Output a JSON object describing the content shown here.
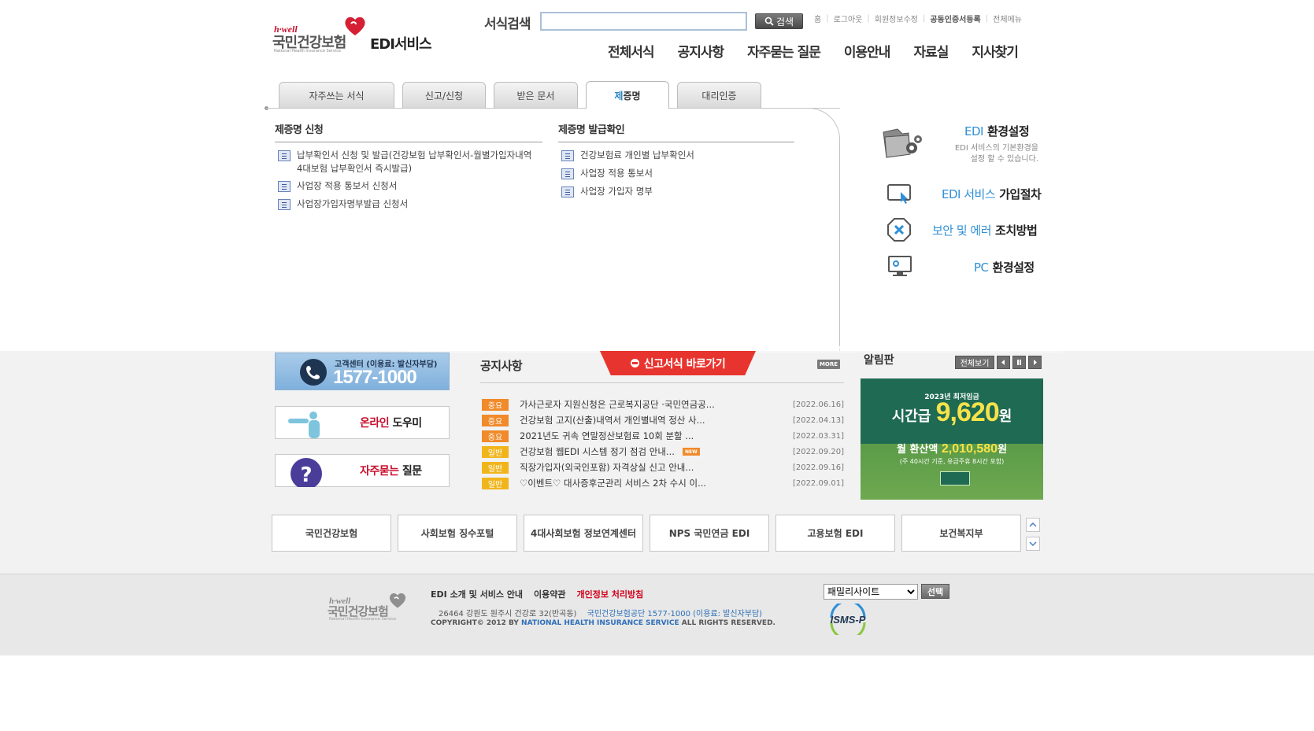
{
  "brand": {
    "hwell": "h·well",
    "name_kr": "국민건강보험",
    "name_en": "National Health Insurance Service",
    "service": "EDI서비스",
    "accent": "#c8102e"
  },
  "search": {
    "label": "서식검색",
    "value": "",
    "placeholder": "",
    "button": "검색"
  },
  "util_links": [
    "홈",
    "로그아웃",
    "회원정보수정",
    "공동인증서등록",
    "전체메뉴"
  ],
  "gnb": [
    "전체서식",
    "공지사항",
    "자주묻는 질문",
    "이용안내",
    "자료실",
    "지사찾기"
  ],
  "tabs": [
    {
      "label": "자주쓰는 서식"
    },
    {
      "label": "신고/신청"
    },
    {
      "label": "받은 문서"
    },
    {
      "label_first": "제",
      "label_rest": "증명",
      "active": true
    },
    {
      "label": "대리인증"
    }
  ],
  "cert_apply": {
    "title": "제증명 신청",
    "items": [
      "납부확인서 신청 및 발급(건강보험 납부확인서-월별가입자내역 4대보험 납부확인서 즉시발급)",
      "사업장 적용 통보서 신청서",
      "사업장가입자명부발급 신청서"
    ]
  },
  "cert_issue": {
    "title": "제증명 발급확인",
    "items": [
      "건강보험료 개인별 납부확인서",
      "사업장 적용 통보서",
      "사업장 가입자 명부"
    ]
  },
  "side_menu": {
    "env": {
      "hl": "EDI",
      "label": "환경설정",
      "desc1": "EDI 서비스의 기본환경을",
      "desc2": "설정 할 수 있습니다."
    },
    "join": {
      "hl": "EDI 서비스",
      "label": "가입절차"
    },
    "security": {
      "hl": "보안 및 에러",
      "label": "조치방법"
    },
    "pc": {
      "hl": "PC",
      "label": "환경설정"
    }
  },
  "customer_center": {
    "label": "고객센터 (이용료: 발신자부담)",
    "number": "1577-1000"
  },
  "quick": {
    "online_red": "온라인",
    "online_rest": " 도우미",
    "faq_red": "자주묻는",
    "faq_rest": " 질문"
  },
  "notice": {
    "title": "공지사항",
    "shortcut": "신고서식 바로가기",
    "more": "MORE",
    "new_label": "NEW",
    "rows": [
      {
        "badge": "중요",
        "type": "important",
        "text": "가사근로자 지원신청은 근로복지공단 ·국민연금공...",
        "date": "[2022.06.16]"
      },
      {
        "badge": "중요",
        "type": "important",
        "text": "건강보험 고지(산출)내역서 개인별내역 정산 사...",
        "date": "[2022.04.13]"
      },
      {
        "badge": "중요",
        "type": "important",
        "text": "2021년도 귀속 연말정산보험료 10회 분할 ...",
        "date": "[2022.03.31]"
      },
      {
        "badge": "일반",
        "type": "normal",
        "text": "건강보험 웹EDI 시스템 정기 점검 안내...",
        "date": "[2022.09.20]",
        "new": true
      },
      {
        "badge": "일반",
        "type": "normal",
        "text": "직장가입자(외국인포함) 자격상실 신고 안내...",
        "date": "[2022.09.16]"
      },
      {
        "badge": "일반",
        "type": "normal",
        "text": "♡이벤트♡ 대사증후군관리 서비스 2차 수시 이...",
        "date": "[2022.09.01]"
      }
    ]
  },
  "board": {
    "title": "알림판",
    "view_all": "전체보기",
    "banner": {
      "line1": "2023년 최저임금",
      "hourly_prefix": "시간급 ",
      "hourly_value": "9,620",
      "hourly_unit": "원",
      "monthly_prefix": "월 환산액 ",
      "monthly_value": "2,010,580",
      "monthly_unit": "원",
      "note": "(주 40시간 기준, 유급주휴 8시간 포함)"
    }
  },
  "family_banners": [
    {
      "label": "국민건강보험"
    },
    {
      "label": "사회보험 징수포털"
    },
    {
      "label": "4대사회보험 정보연계센터"
    },
    {
      "label": "NPS 국민연금 EDI"
    },
    {
      "label": "고용보험 EDI"
    },
    {
      "label": "보건복지부"
    }
  ],
  "footer": {
    "links": [
      "EDI 소개 및 서비스 안내",
      "이용약관",
      "개인정보 처리방침"
    ],
    "address": "26464 강원도 원주시 건강로 32(반곡동)",
    "contact": "국민건강보험공단 1577-1000 (이용료: 발신자부담)",
    "copy_prefix": "COPYRIGHT© 2012 BY ",
    "copy_org": "NATIONAL HEALTH INSURANCE SERVICE",
    "copy_suffix": " ALL RIGHTS RESERVED.",
    "family_select": "패밀리사이트",
    "select_button": "선택",
    "isms": "ISMS-P"
  }
}
